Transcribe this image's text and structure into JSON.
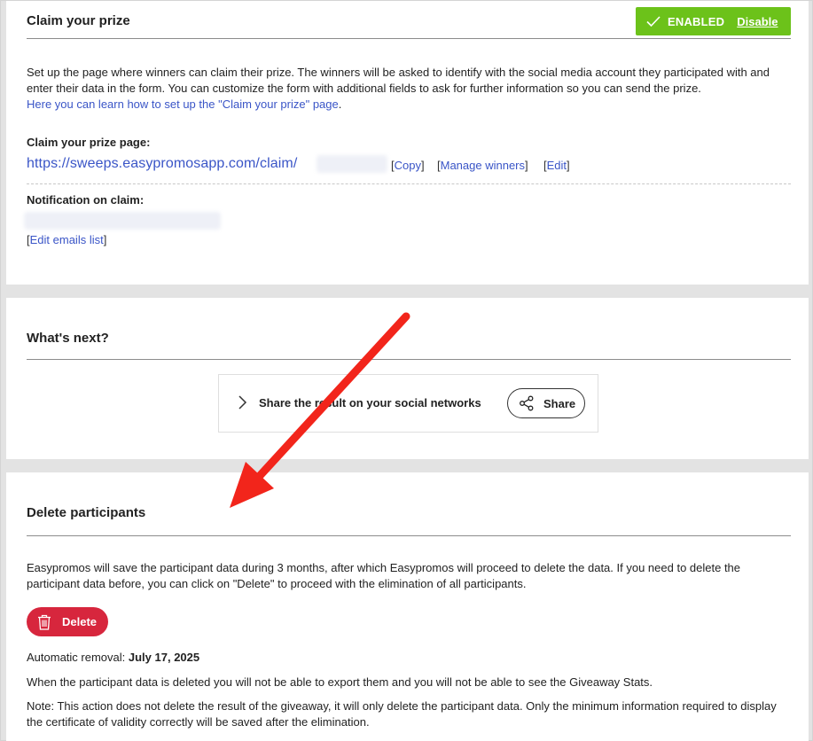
{
  "claim_section": {
    "title": "Claim your prize",
    "status_label": "ENABLED",
    "disable_label": "Disable",
    "description": "Set up the page where winners can claim their prize. The winners will be asked to identify with the social media account they participated with and enter their data in the form. You can customize the form with additional fields to ask for further information so you can send the prize.",
    "learn_link": "Here you can learn how to set up the \"Claim your prize\" page",
    "learn_link_suffix": ".",
    "page_label": "Claim your prize page:",
    "page_url": "https://sweeps.easypromosapp.com/claim/",
    "copy_label": "Copy",
    "manage_winners_label": "Manage winners",
    "edit_label": "Edit",
    "notification_label": "Notification on claim:",
    "edit_emails_label": "Edit emails list",
    "accent_color": "#6cc21a",
    "link_color": "#3a55c7"
  },
  "next_section": {
    "title": "What's next?",
    "share_text": "Share the result on your social networks",
    "share_button": "Share"
  },
  "delete_section": {
    "title": "Delete participants",
    "description": "Easypromos will save the participant data during 3 months, after which Easypromos will proceed to delete the data. If you need to delete the participant data before, you can click on \"Delete\" to proceed with the elimination of all participants.",
    "delete_button": "Delete",
    "auto_removal_label": "Automatic removal:",
    "auto_removal_date": "July 17, 2025",
    "warning_text": "When the participant data is deleted you will not be able to export them and you will not be able to see the Giveaway Stats.",
    "note_text": "Note: This action does not delete the result of the giveaway, it will only delete the participant data. Only the minimum information required to display the certificate of validity correctly will be saved after the elimination.",
    "danger_color": "#d7263d"
  },
  "annotation": {
    "arrow_color": "#f2251b"
  }
}
